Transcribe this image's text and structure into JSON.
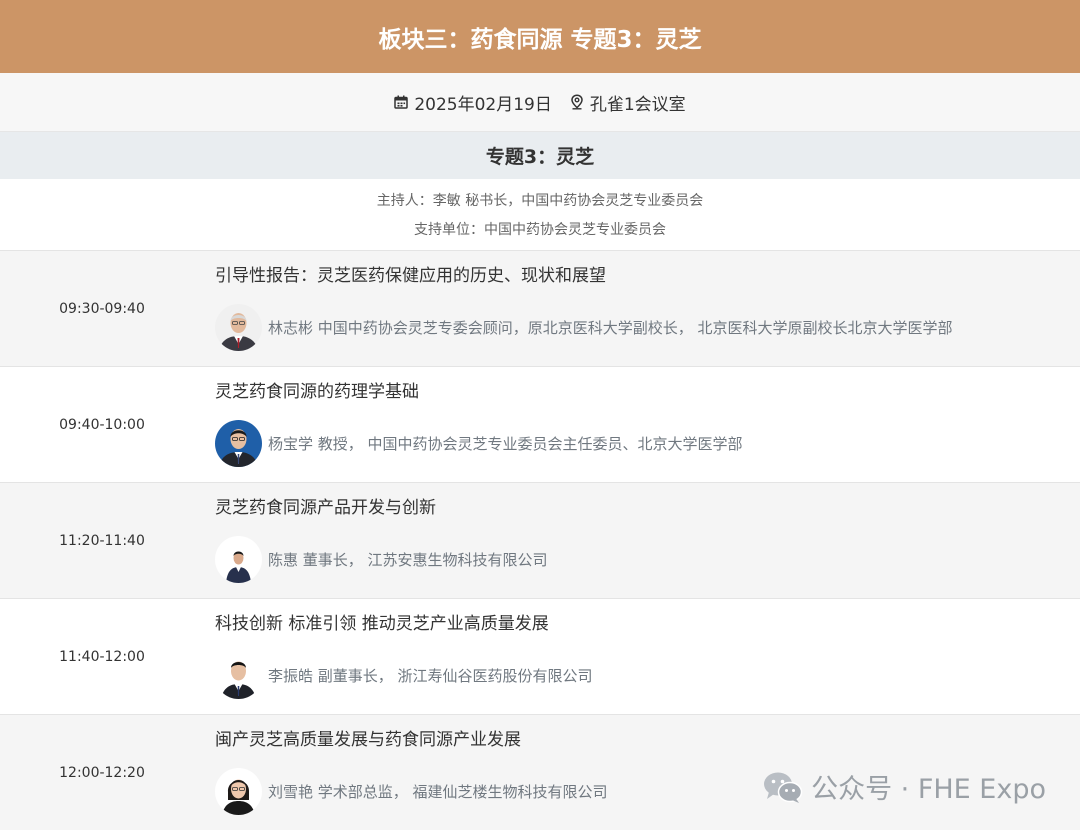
{
  "banner": {
    "title": "板块三：药食同源 专题3：灵芝"
  },
  "meta": {
    "date": "2025年02月19日",
    "location": "孔雀1会议室",
    "icons": {
      "date": "calendar-icon",
      "location": "location-pin-icon"
    }
  },
  "topic": {
    "title": "专题3：灵芝",
    "host": "主持人：李敏 秘书长，中国中药协会灵芝专业委员会",
    "support": "支持单位：中国中药协会灵芝专业委员会"
  },
  "sessions": [
    {
      "time": "09:30-09:40",
      "title": "引导性报告：灵芝医药保健应用的历史、现状和展望",
      "speaker": "林志彬 中国中药协会灵芝专委会顾问，原北京医科大学副校长， 北京医科大学原副校长北京大学医学部"
    },
    {
      "time": "09:40-10:00",
      "title": "灵芝药食同源的药理学基础",
      "speaker": "杨宝学 教授， 中国中药协会灵芝专业委员会主任委员、北京大学医学部"
    },
    {
      "time": "11:20-11:40",
      "title": "灵芝药食同源产品开发与创新",
      "speaker": "陈惠 董事长， 江苏安惠生物科技有限公司"
    },
    {
      "time": "11:40-12:00",
      "title": "科技创新 标准引领 推动灵芝产业高质量发展",
      "speaker": "李振皓 副董事长， 浙江寿仙谷医药股份有限公司"
    },
    {
      "time": "12:00-12:20",
      "title": "闽产灵芝高质量发展与药食同源产业发展",
      "speaker": "刘雪艳 学术部总监， 福建仙芝楼生物科技有限公司"
    }
  ],
  "watermark": {
    "text": "公众号 · FHE Expo",
    "icon": "wechat-icon"
  },
  "colors": {
    "banner_bg": "#cc9566",
    "topic_bg": "#e9edf0",
    "row_shaded": "#f5f5f5",
    "speaker_text": "#707880"
  }
}
